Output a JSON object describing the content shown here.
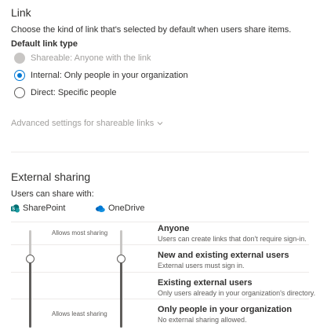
{
  "link": {
    "title": "Link",
    "description": "Choose the kind of link that's selected by default when users share items.",
    "default_label": "Default link type",
    "options": [
      {
        "label": "Shareable: Anyone with the link",
        "state": "disabled"
      },
      {
        "label": "Internal: Only people in your organization",
        "state": "checked"
      },
      {
        "label": "Direct: Specific people",
        "state": "unchecked"
      }
    ],
    "advanced": "Advanced settings for shareable links"
  },
  "external": {
    "title": "External sharing",
    "users_can_share": "Users can share with:",
    "sharepoint_label": "SharePoint",
    "onedrive_label": "OneDrive",
    "most_label": "Allows most sharing",
    "least_label": "Allows least sharing",
    "levels": [
      {
        "title": "Anyone",
        "desc": "Users can create links that don't require sign-in."
      },
      {
        "title": "New and existing external users",
        "desc": "External users must sign in."
      },
      {
        "title": "Existing external users",
        "desc": "Only users already in your organization's directory."
      },
      {
        "title": "Only people in your organization",
        "desc": "No external sharing allowed."
      }
    ],
    "sharepoint_level": "New and existing external users",
    "onedrive_level": "New and existing external users"
  },
  "colors": {
    "accent": "#0078d4",
    "sharepoint": "#036c70",
    "onedrive": "#0364b8"
  }
}
